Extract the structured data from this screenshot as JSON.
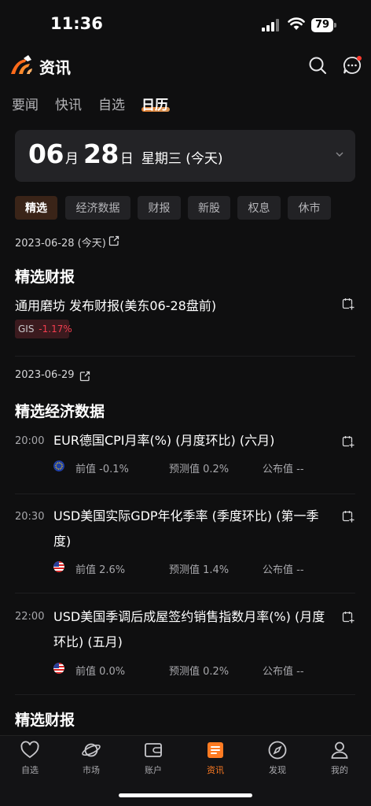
{
  "status": {
    "time": "11:36",
    "battery": "79"
  },
  "header": {
    "title": "资讯"
  },
  "tabs": [
    "要闻",
    "快讯",
    "自选",
    "日历"
  ],
  "date_card": {
    "month": "06",
    "month_unit": "月",
    "day": "28",
    "day_unit": "日",
    "weekday": "星期三 (今天)"
  },
  "chips": [
    "精选",
    "经济数据",
    "财报",
    "新股",
    "权息",
    "休市"
  ],
  "day1": {
    "date": "2023-06-28 (今天)",
    "section": "精选财报",
    "item": {
      "title": "通用磨坊 发布财报(美东06-28盘前)",
      "ticker": "GIS",
      "change": "-1.17%"
    }
  },
  "day2": {
    "date": "2023-06-29",
    "section": "精选经济数据",
    "events": [
      {
        "time": "20:00",
        "title": "EUR德国CPI月率(%) (月度环比) (六月)",
        "prev": "前值 -0.1%",
        "forecast": "预测值 0.2%",
        "actual": "公布值 --"
      },
      {
        "time": "20:30",
        "title": "USD美国实际GDP年化季率 (季度环比) (第一季度)",
        "prev": "前值 2.6%",
        "forecast": "预测值 1.4%",
        "actual": "公布值 --"
      },
      {
        "time": "22:00",
        "title": "USD美国季调后成屋签约销售指数月率(%) (月度环比) (五月)",
        "prev": "前值 0.0%",
        "forecast": "预测值 0.2%",
        "actual": "公布值 --"
      }
    ],
    "next_section": "精选财报"
  },
  "nav": [
    "自选",
    "市场",
    "账户",
    "资讯",
    "发现",
    "我的"
  ],
  "colors": {
    "accent": "#ff7b22",
    "negative": "#f23d4f",
    "background": "#0f0f10",
    "card": "#232326"
  }
}
